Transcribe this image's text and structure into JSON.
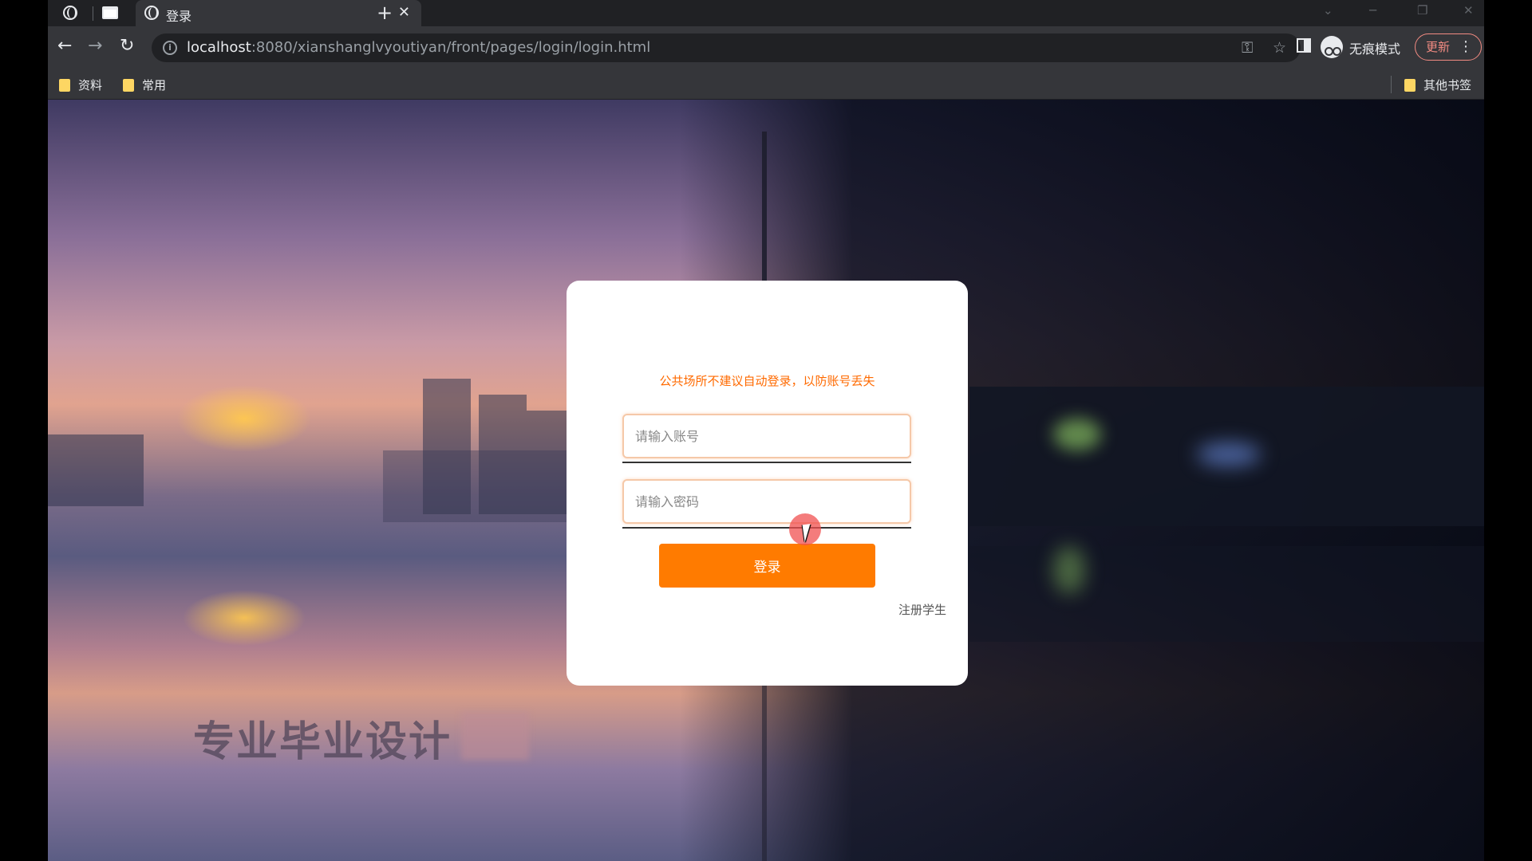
{
  "browser": {
    "tab": {
      "title": "登录"
    },
    "new_tab_symbol": "+",
    "close_symbol": "✕",
    "url": {
      "host": "localhost",
      "rest": ":8080/xianshanglvyoutiyan/front/pages/login/login.html"
    },
    "incognito_label": "无痕模式",
    "update_label": "更新",
    "bookmarks": [
      {
        "label": "资料"
      },
      {
        "label": "常用"
      }
    ],
    "other_bookmarks_label": "其他书签"
  },
  "page": {
    "watermark_text": "专业毕业设计",
    "login_card": {
      "notice": "公共场所不建议自动登录，以防账号丢失",
      "account_placeholder": "请输入账号",
      "password_placeholder": "请输入密码",
      "login_button_label": "登录",
      "register_link": "注册学生"
    }
  },
  "colors": {
    "accent_orange": "#ff7b00",
    "notice_orange": "#ff6a00",
    "update_red": "#f28b82",
    "folder_yellow": "#fdd663"
  },
  "icons": [
    "globe-icon",
    "window-icon",
    "close-icon",
    "new-tab-icon",
    "back-icon",
    "forward-icon",
    "reload-icon",
    "info-icon",
    "key-icon",
    "star-icon",
    "side-panel-icon",
    "incognito-icon",
    "more-icon",
    "folder-icon"
  ]
}
